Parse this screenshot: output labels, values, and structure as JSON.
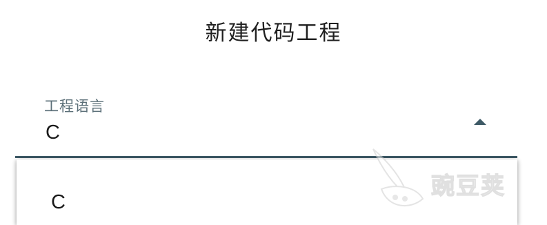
{
  "dialog": {
    "title": "新建代码工程"
  },
  "language_field": {
    "label": "工程语言",
    "selected_value": "C"
  },
  "dropdown_menu": {
    "items": [
      {
        "label": "C"
      }
    ]
  },
  "watermark": {
    "text": "豌豆荚"
  },
  "colors": {
    "accent": "#3e5a66",
    "label": "#5b6f78",
    "text": "#1a1a1a",
    "background": "#ffffff"
  },
  "icons": {
    "dropdown_toggle": "caret-up-icon"
  }
}
